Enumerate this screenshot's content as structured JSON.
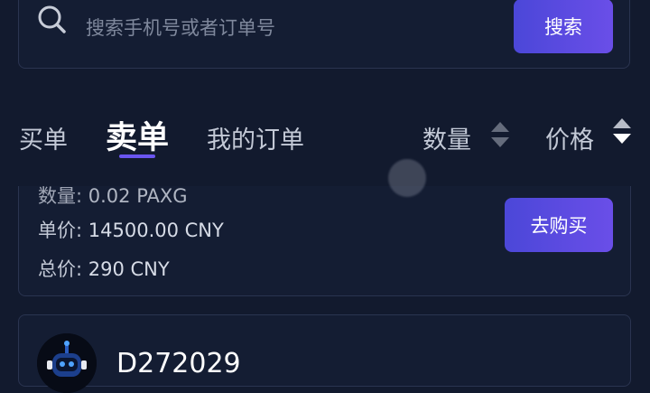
{
  "search": {
    "placeholder": "搜索手机号或者订单号",
    "button_label": "搜索"
  },
  "tabs": [
    {
      "label": "买单",
      "active": false
    },
    {
      "label": "卖单",
      "active": true
    },
    {
      "label": "我的订单",
      "active": false
    }
  ],
  "sort": {
    "quantity_label": "数量",
    "price_label": "价格",
    "price_direction": "descending"
  },
  "order": {
    "quantity_label": "数量:",
    "quantity_value": "0.02 PAXG",
    "unit_price_label": "单价:",
    "unit_price_value": "14500.00 CNY",
    "total_label": "总价:",
    "total_value": "290 CNY",
    "buy_button_label": "去购买"
  },
  "next_order": {
    "username": "D272029"
  },
  "colors": {
    "background": "#121a2e",
    "card": "#141d33",
    "accent": "#5a4be0",
    "active_tab_indicator": "#6a55f0"
  }
}
